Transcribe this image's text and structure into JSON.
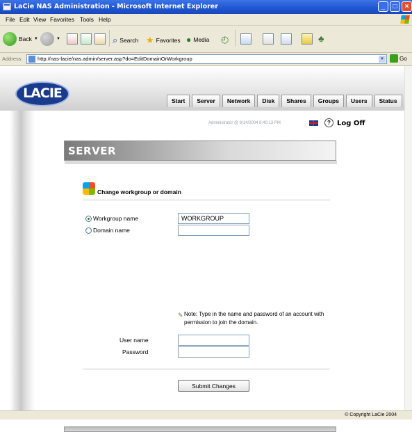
{
  "window": {
    "title": "LaCie NAS Administration - Microsoft Internet Explorer",
    "controls": [
      "_",
      "□",
      "×"
    ]
  },
  "menu": [
    "File",
    "Edit",
    "View",
    "Favorites",
    "Tools",
    "Help"
  ],
  "toolbar": {
    "back_label": "Back",
    "search_label": "Search",
    "favorites_label": "Favorites",
    "media_label": "Media"
  },
  "address": {
    "label": "Address",
    "url": "http://nas-lacie/nas.admin/server.asp?do=EditDomainOrWorkgroup",
    "go_label": "Go"
  },
  "header": {
    "logo_text": "LACIE",
    "tabs": [
      "Start",
      "Server",
      "Network",
      "Disk",
      "Shares",
      "Groups",
      "Users",
      "Status"
    ],
    "user_info": "Administrator @ 8/14/2004 8:40:13 PM",
    "logoff_label": "Log Off"
  },
  "page": {
    "section_title": "SERVER",
    "form_title": "Change workgroup or domain",
    "workgroup_label": "Workgroup name",
    "workgroup_value": "WORKGROUP",
    "domain_label": "Domain name",
    "domain_value": "",
    "note": "Note: Type in the name and password of an account with permission to join the domain.",
    "username_label": "User name",
    "password_label": "Password",
    "submit_label": "Submit Changes"
  },
  "status": {
    "copyright": "© Copyright LaCie 2004"
  }
}
